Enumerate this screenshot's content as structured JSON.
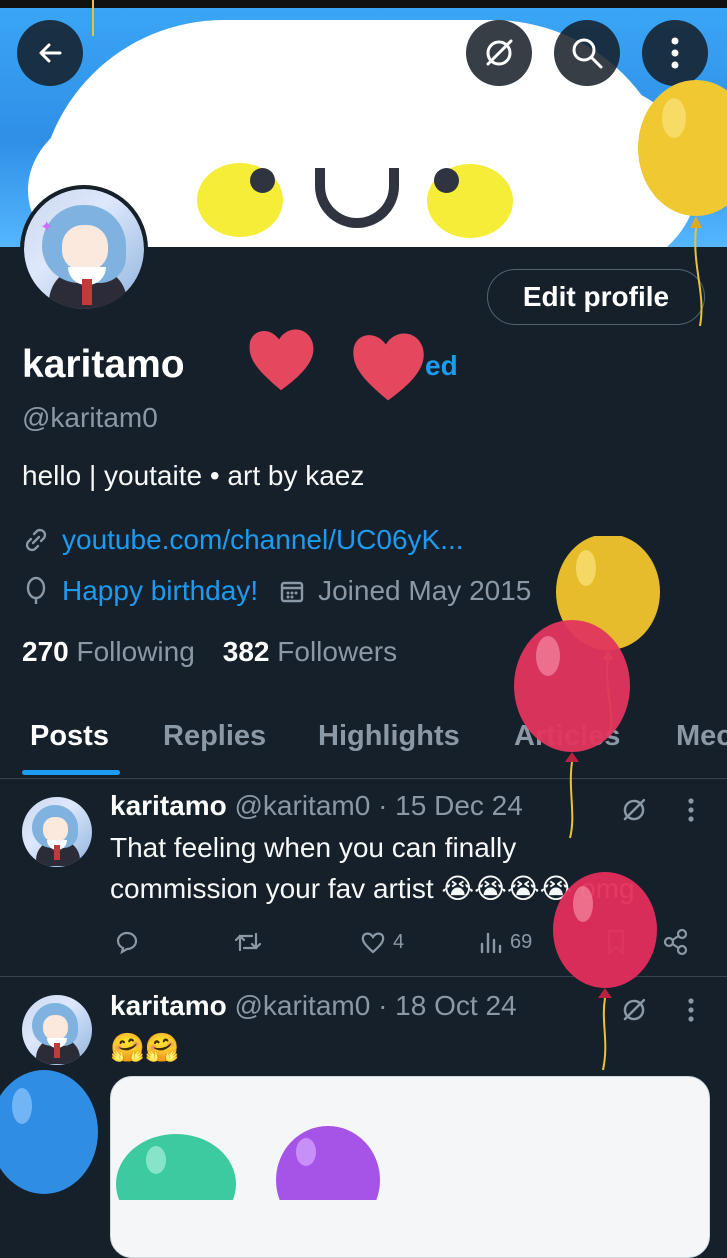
{
  "header": {
    "back_icon": "arrow-left-icon",
    "grok_icon": "grok-icon",
    "search_icon": "search-icon",
    "more_icon": "more-vertical-icon"
  },
  "profile": {
    "edit_label": "Edit profile",
    "name": "karitamo",
    "verified_fragment": "ed",
    "handle": "@karitam0",
    "bio": "hello | youtaite •  art by kaez",
    "link_text": "youtube.com/channel/UC06yK...",
    "birthday_text": "Happy birthday!",
    "joined_text": "Joined May 2015",
    "following_count": "270",
    "following_label": "Following",
    "followers_count": "382",
    "followers_label": "Followers"
  },
  "tabs": [
    {
      "label": "Posts",
      "active": true
    },
    {
      "label": "Replies",
      "active": false
    },
    {
      "label": "Highlights",
      "active": false
    },
    {
      "label": "Articles",
      "active": false
    },
    {
      "label": "Mec",
      "active": false
    }
  ],
  "posts": [
    {
      "author": "karitamo",
      "handle": "@karitam0",
      "date": "· 15 Dec 24",
      "text_line1": "That feeling when you can finally",
      "text_line2": "commission your fav artist 😭😭😭😭 omg",
      "likes": "4",
      "views": "69"
    },
    {
      "author": "karitamo",
      "handle": "@karitam0",
      "date": "· 18 Oct 24",
      "text_line1": "🤗🤗"
    }
  ],
  "colors": {
    "background": "#15202b",
    "accent": "#1d9bf0",
    "muted": "#8b98a5",
    "divider": "#38444d"
  }
}
